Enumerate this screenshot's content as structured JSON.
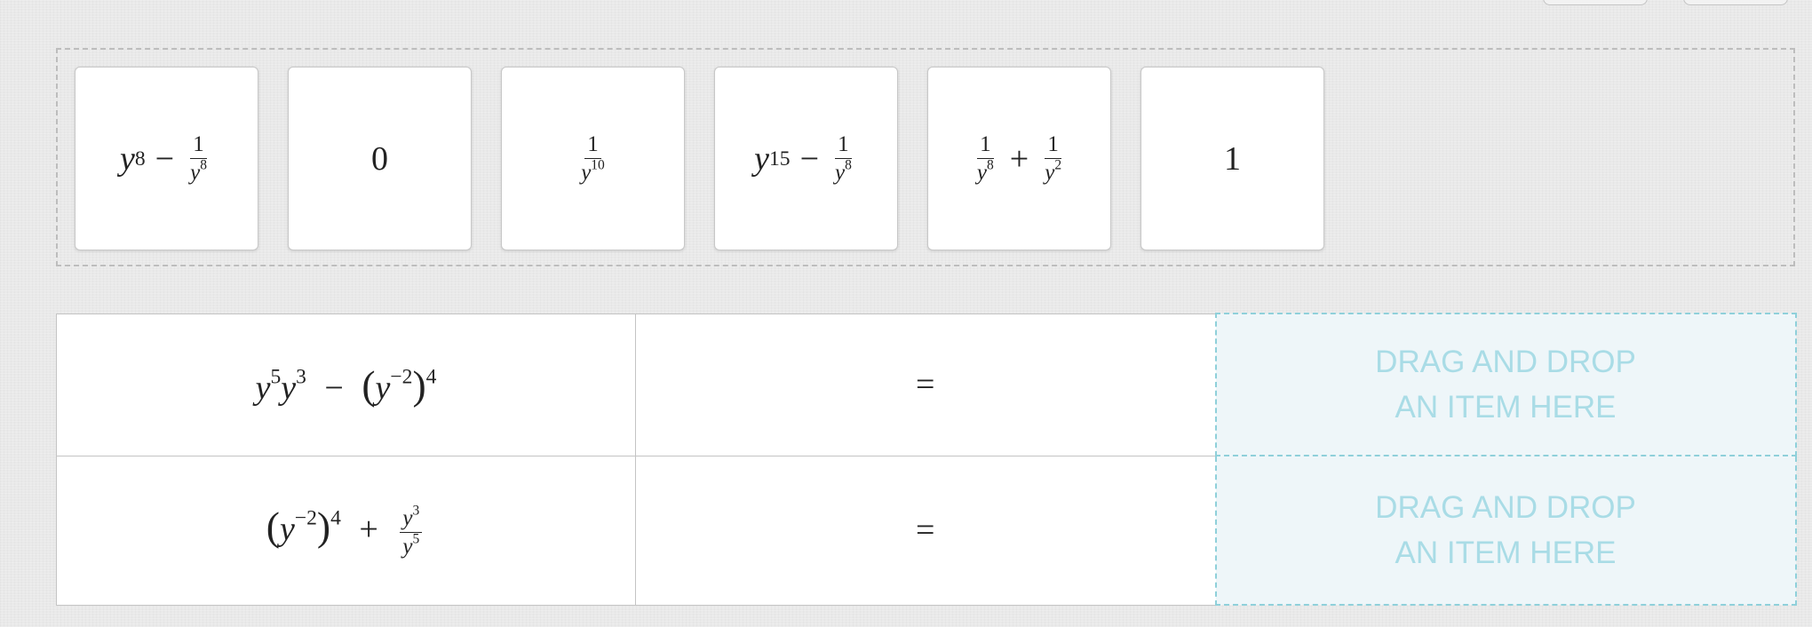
{
  "bank": {
    "tiles": [
      {
        "id": "t1",
        "math": "y^8 − 1/y^8"
      },
      {
        "id": "t2",
        "math": "0"
      },
      {
        "id": "t3",
        "math": "1/y^10"
      },
      {
        "id": "t4",
        "math": "y^15 − 1/y^8"
      },
      {
        "id": "t5",
        "math": "1/y^8 + 1/y^2"
      },
      {
        "id": "t6",
        "math": "1"
      }
    ]
  },
  "rows": [
    {
      "expression": "y^5 y^3 − (y^−2)^4",
      "equals": "=",
      "drop_line1": "DRAG AND DROP",
      "drop_line2": "AN ITEM HERE"
    },
    {
      "expression": "(y^−2)^4 + y^3/y^5",
      "equals": "=",
      "drop_line1": "DRAG AND DROP",
      "drop_line2": "AN ITEM HERE"
    }
  ],
  "math_parts": {
    "y": "y",
    "one": "1",
    "zero": "0",
    "minus": "−",
    "plus": "+",
    "lp": "(",
    "rp": ")",
    "e8": "8",
    "e15": "15",
    "e10": "10",
    "e2": "2",
    "e5": "5",
    "e3": "3",
    "e4": "4",
    "em2": "−2"
  },
  "colors": {
    "drop_border": "#8fd0da",
    "drop_text": "#a9dce6",
    "drop_bg": "#eef6f9"
  }
}
